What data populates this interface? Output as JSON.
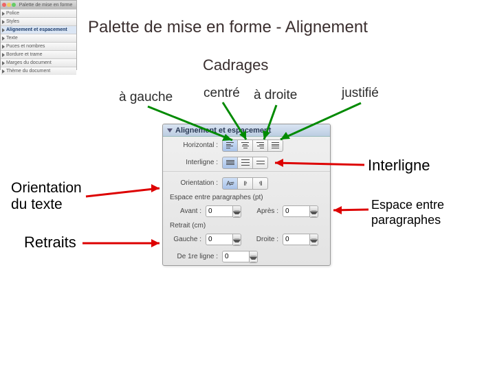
{
  "title": "Palette de mise en forme - Alignement",
  "subtitle": "Cadrages",
  "annotations": {
    "gauche": "à gauche",
    "centre": "centré",
    "droite": "à droite",
    "justifie": "justifié",
    "interligne": "Interligne",
    "orientation": "Orientation\ndu texte",
    "espace": "Espace entre\nparagraphes",
    "retraits": "Retraits"
  },
  "mini_palette": {
    "title": "Palette de mise en forme",
    "rows": [
      "Police",
      "Styles",
      "Alignement et espacement",
      "Texte",
      "Puces et nombres",
      "Bordure et trame",
      "Marges du document",
      "Thème du document"
    ],
    "selected": 2
  },
  "panel": {
    "header": "Alignement et espacement",
    "horizontal": {
      "label": "Horizontal :",
      "selected": 0
    },
    "interligne": {
      "label": "Interligne :",
      "selected": 0
    },
    "orientation": {
      "label": "Orientation :",
      "selected": 0
    },
    "espace_label": "Espace entre paragraphes (pt)",
    "avant": {
      "label": "Avant :",
      "value": "0"
    },
    "apres": {
      "label": "Après :",
      "value": "0"
    },
    "retrait_label": "Retrait (cm)",
    "gauche": {
      "label": "Gauche :",
      "value": "0"
    },
    "droite": {
      "label": "Droite :",
      "value": "0"
    },
    "premiere": {
      "label": "De 1re ligne :",
      "value": "0"
    }
  }
}
